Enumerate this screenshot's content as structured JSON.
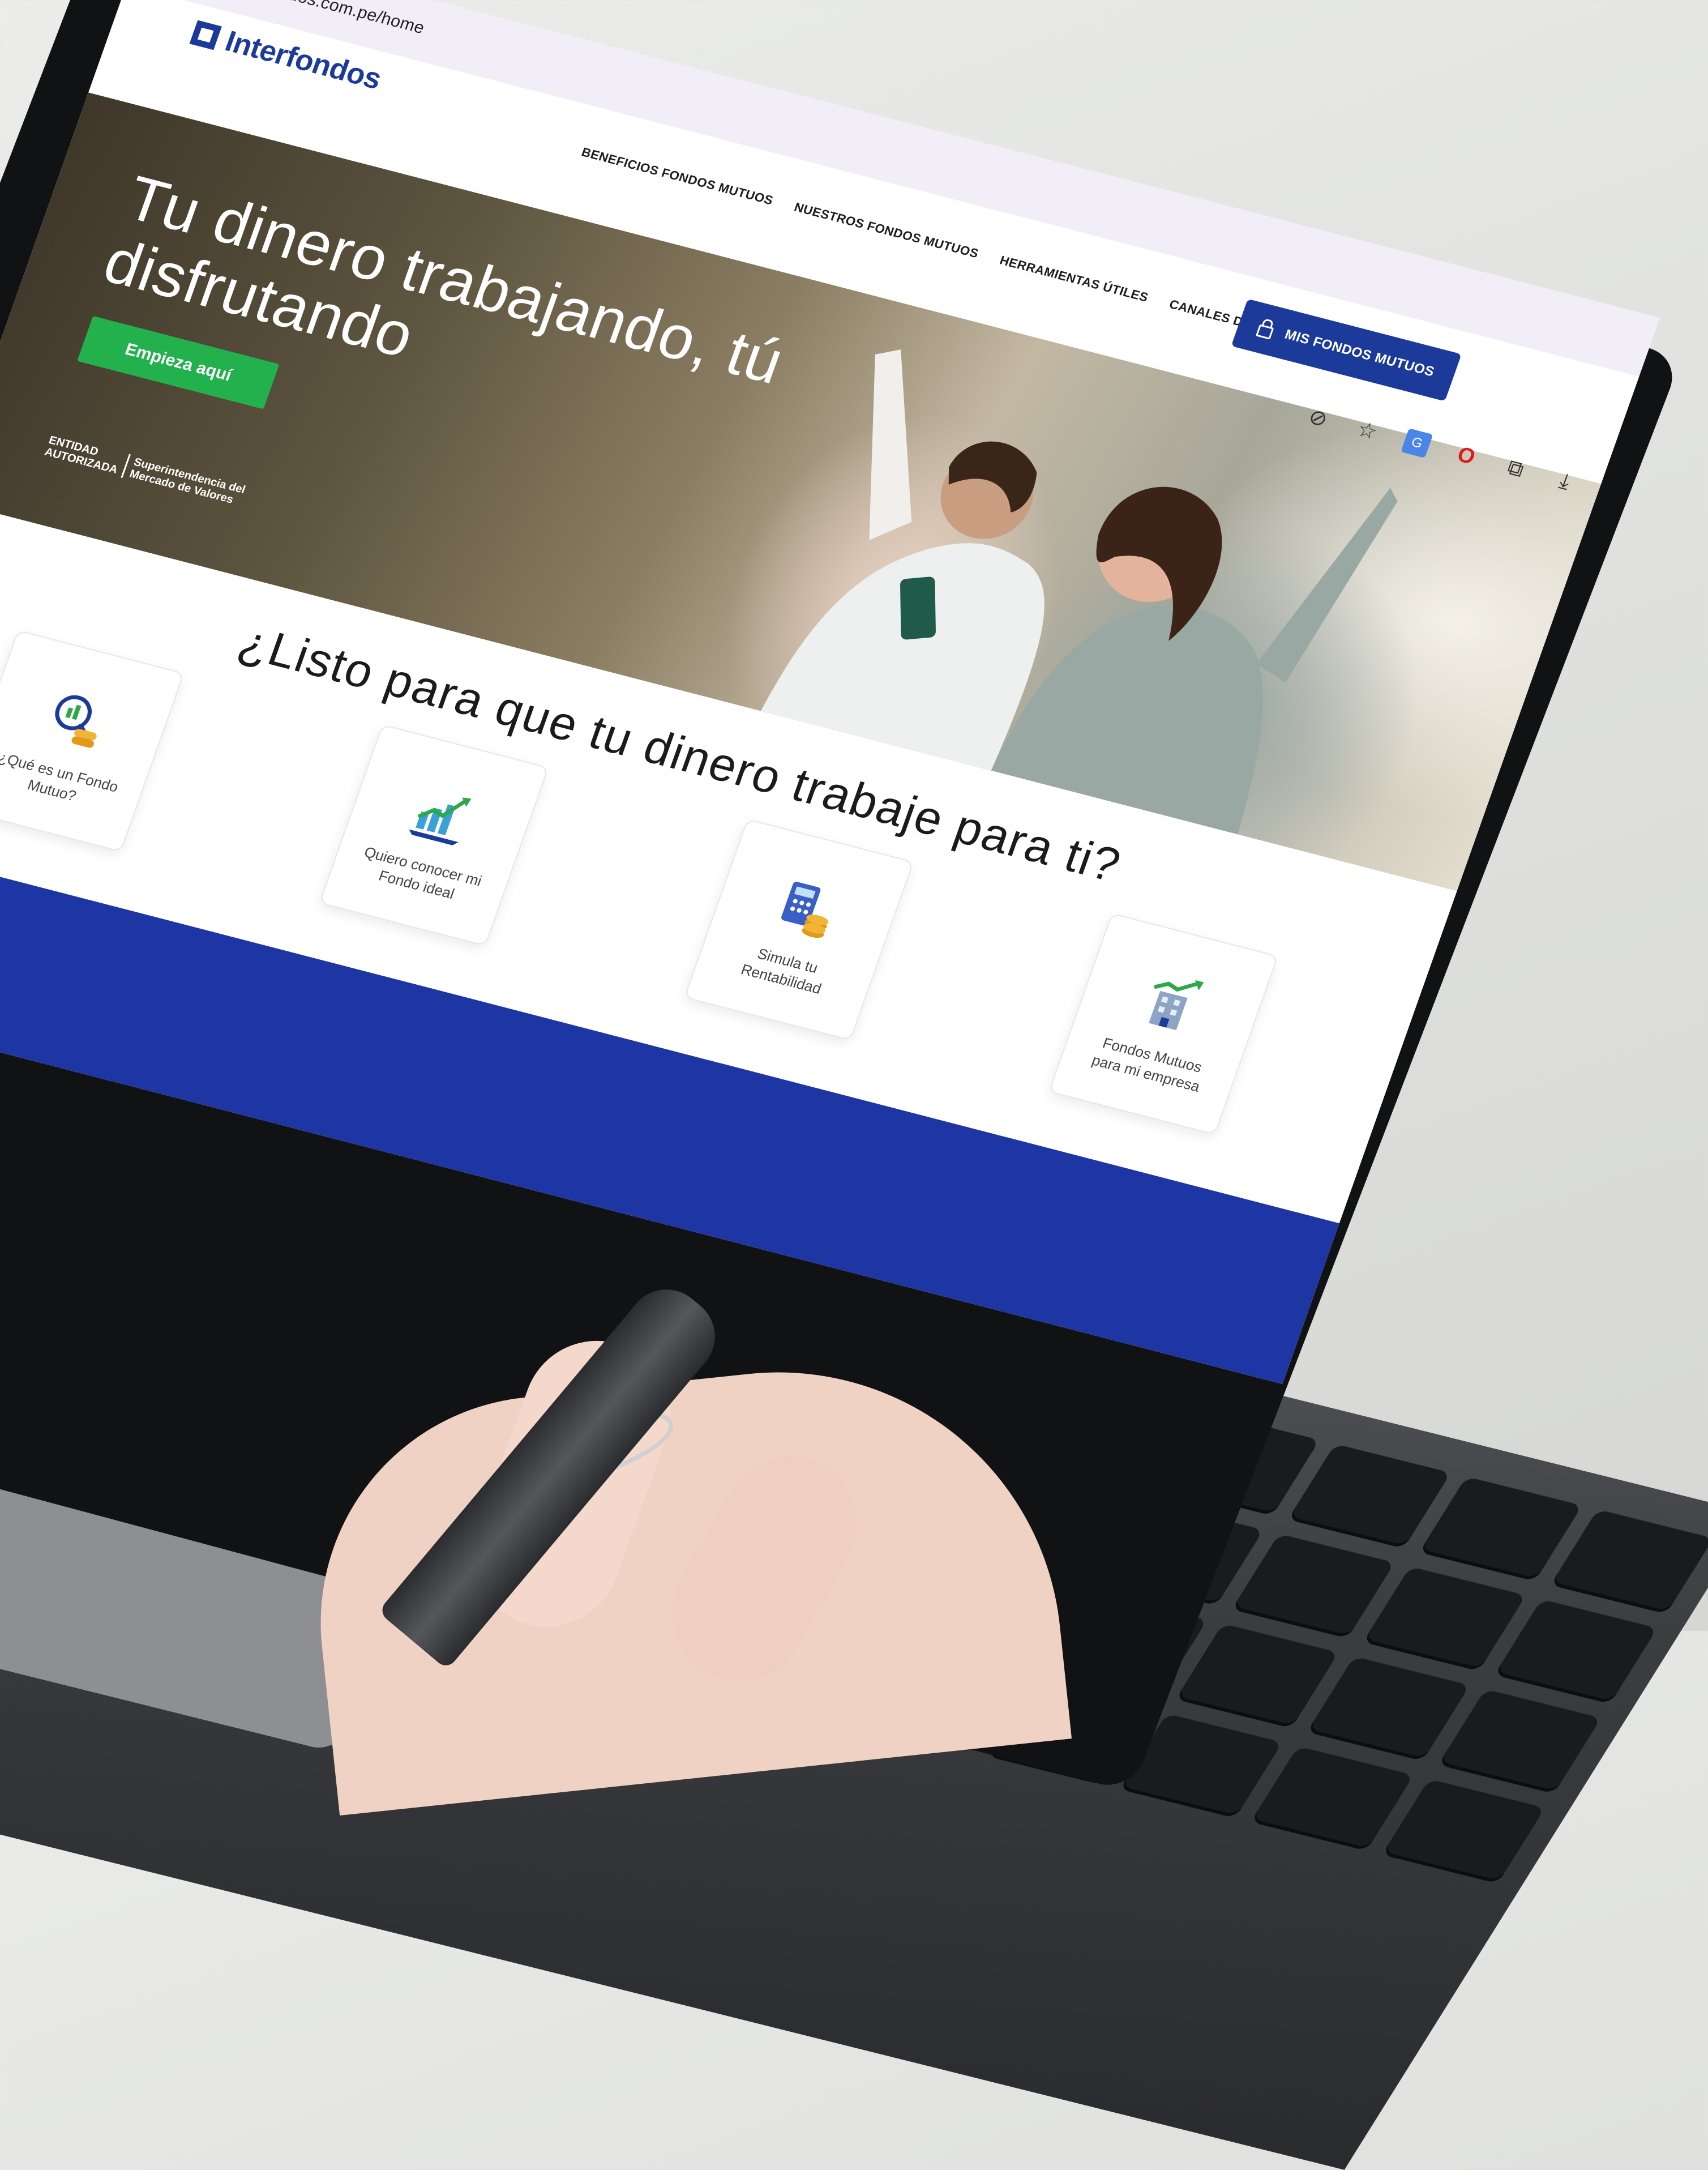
{
  "browser": {
    "url": "ndos.com.pe/home"
  },
  "header": {
    "logo_text": "Interfondos",
    "nav": [
      "BENEFICIOS FONDOS MUTUOS",
      "NUESTROS FONDOS MUTUOS",
      "HERRAMIENTAS ÚTILES",
      "CANALES DIGITALES"
    ],
    "cta": "MIS FONDOS MUTUOS",
    "brand_color": "#1c3a9a"
  },
  "hero": {
    "title": "Tu dinero trabajando, tú disfrutando",
    "button": "Empieza aquí",
    "button_color": "#23b14d",
    "entidad_line1": "ENTIDAD",
    "entidad_line2": "AUTORIZADA",
    "regulator_line1": "Superintendencia del",
    "regulator_line2": "Mercado de Valores"
  },
  "section": {
    "title": "¿Listo para que tu dinero trabaje para ti?",
    "cards": [
      {
        "label": "¿Qué es un Fondo Mutuo?",
        "icon": "magnifier-coins-icon"
      },
      {
        "label": "Quiero conocer mi Fondo ideal",
        "icon": "growth-chart-icon"
      },
      {
        "label": "Simula tu Rentabilidad",
        "icon": "calculator-coins-icon"
      },
      {
        "label": "Fondos Mutuos para mi empresa",
        "icon": "building-growth-icon"
      }
    ]
  },
  "extensions": [
    "hide-icon",
    "star-icon",
    "translate-icon",
    "opera-icon",
    "puzzle-icon",
    "download-icon"
  ]
}
